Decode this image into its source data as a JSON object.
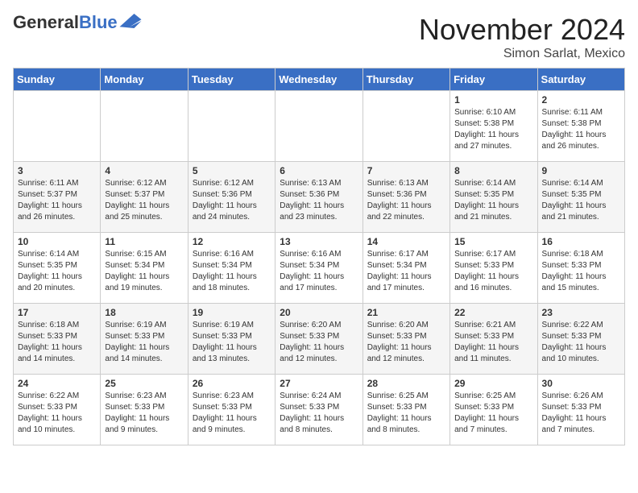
{
  "header": {
    "logo_line1": "General",
    "logo_line2": "Blue",
    "month_title": "November 2024",
    "subtitle": "Simon Sarlat, Mexico"
  },
  "days_of_week": [
    "Sunday",
    "Monday",
    "Tuesday",
    "Wednesday",
    "Thursday",
    "Friday",
    "Saturday"
  ],
  "weeks": [
    [
      {
        "day": "",
        "info": ""
      },
      {
        "day": "",
        "info": ""
      },
      {
        "day": "",
        "info": ""
      },
      {
        "day": "",
        "info": ""
      },
      {
        "day": "",
        "info": ""
      },
      {
        "day": "1",
        "info": "Sunrise: 6:10 AM\nSunset: 5:38 PM\nDaylight: 11 hours and 27 minutes."
      },
      {
        "day": "2",
        "info": "Sunrise: 6:11 AM\nSunset: 5:38 PM\nDaylight: 11 hours and 26 minutes."
      }
    ],
    [
      {
        "day": "3",
        "info": "Sunrise: 6:11 AM\nSunset: 5:37 PM\nDaylight: 11 hours and 26 minutes."
      },
      {
        "day": "4",
        "info": "Sunrise: 6:12 AM\nSunset: 5:37 PM\nDaylight: 11 hours and 25 minutes."
      },
      {
        "day": "5",
        "info": "Sunrise: 6:12 AM\nSunset: 5:36 PM\nDaylight: 11 hours and 24 minutes."
      },
      {
        "day": "6",
        "info": "Sunrise: 6:13 AM\nSunset: 5:36 PM\nDaylight: 11 hours and 23 minutes."
      },
      {
        "day": "7",
        "info": "Sunrise: 6:13 AM\nSunset: 5:36 PM\nDaylight: 11 hours and 22 minutes."
      },
      {
        "day": "8",
        "info": "Sunrise: 6:14 AM\nSunset: 5:35 PM\nDaylight: 11 hours and 21 minutes."
      },
      {
        "day": "9",
        "info": "Sunrise: 6:14 AM\nSunset: 5:35 PM\nDaylight: 11 hours and 21 minutes."
      }
    ],
    [
      {
        "day": "10",
        "info": "Sunrise: 6:14 AM\nSunset: 5:35 PM\nDaylight: 11 hours and 20 minutes."
      },
      {
        "day": "11",
        "info": "Sunrise: 6:15 AM\nSunset: 5:34 PM\nDaylight: 11 hours and 19 minutes."
      },
      {
        "day": "12",
        "info": "Sunrise: 6:16 AM\nSunset: 5:34 PM\nDaylight: 11 hours and 18 minutes."
      },
      {
        "day": "13",
        "info": "Sunrise: 6:16 AM\nSunset: 5:34 PM\nDaylight: 11 hours and 17 minutes."
      },
      {
        "day": "14",
        "info": "Sunrise: 6:17 AM\nSunset: 5:34 PM\nDaylight: 11 hours and 17 minutes."
      },
      {
        "day": "15",
        "info": "Sunrise: 6:17 AM\nSunset: 5:33 PM\nDaylight: 11 hours and 16 minutes."
      },
      {
        "day": "16",
        "info": "Sunrise: 6:18 AM\nSunset: 5:33 PM\nDaylight: 11 hours and 15 minutes."
      }
    ],
    [
      {
        "day": "17",
        "info": "Sunrise: 6:18 AM\nSunset: 5:33 PM\nDaylight: 11 hours and 14 minutes."
      },
      {
        "day": "18",
        "info": "Sunrise: 6:19 AM\nSunset: 5:33 PM\nDaylight: 11 hours and 14 minutes."
      },
      {
        "day": "19",
        "info": "Sunrise: 6:19 AM\nSunset: 5:33 PM\nDaylight: 11 hours and 13 minutes."
      },
      {
        "day": "20",
        "info": "Sunrise: 6:20 AM\nSunset: 5:33 PM\nDaylight: 11 hours and 12 minutes."
      },
      {
        "day": "21",
        "info": "Sunrise: 6:20 AM\nSunset: 5:33 PM\nDaylight: 11 hours and 12 minutes."
      },
      {
        "day": "22",
        "info": "Sunrise: 6:21 AM\nSunset: 5:33 PM\nDaylight: 11 hours and 11 minutes."
      },
      {
        "day": "23",
        "info": "Sunrise: 6:22 AM\nSunset: 5:33 PM\nDaylight: 11 hours and 10 minutes."
      }
    ],
    [
      {
        "day": "24",
        "info": "Sunrise: 6:22 AM\nSunset: 5:33 PM\nDaylight: 11 hours and 10 minutes."
      },
      {
        "day": "25",
        "info": "Sunrise: 6:23 AM\nSunset: 5:33 PM\nDaylight: 11 hours and 9 minutes."
      },
      {
        "day": "26",
        "info": "Sunrise: 6:23 AM\nSunset: 5:33 PM\nDaylight: 11 hours and 9 minutes."
      },
      {
        "day": "27",
        "info": "Sunrise: 6:24 AM\nSunset: 5:33 PM\nDaylight: 11 hours and 8 minutes."
      },
      {
        "day": "28",
        "info": "Sunrise: 6:25 AM\nSunset: 5:33 PM\nDaylight: 11 hours and 8 minutes."
      },
      {
        "day": "29",
        "info": "Sunrise: 6:25 AM\nSunset: 5:33 PM\nDaylight: 11 hours and 7 minutes."
      },
      {
        "day": "30",
        "info": "Sunrise: 6:26 AM\nSunset: 5:33 PM\nDaylight: 11 hours and 7 minutes."
      }
    ]
  ]
}
